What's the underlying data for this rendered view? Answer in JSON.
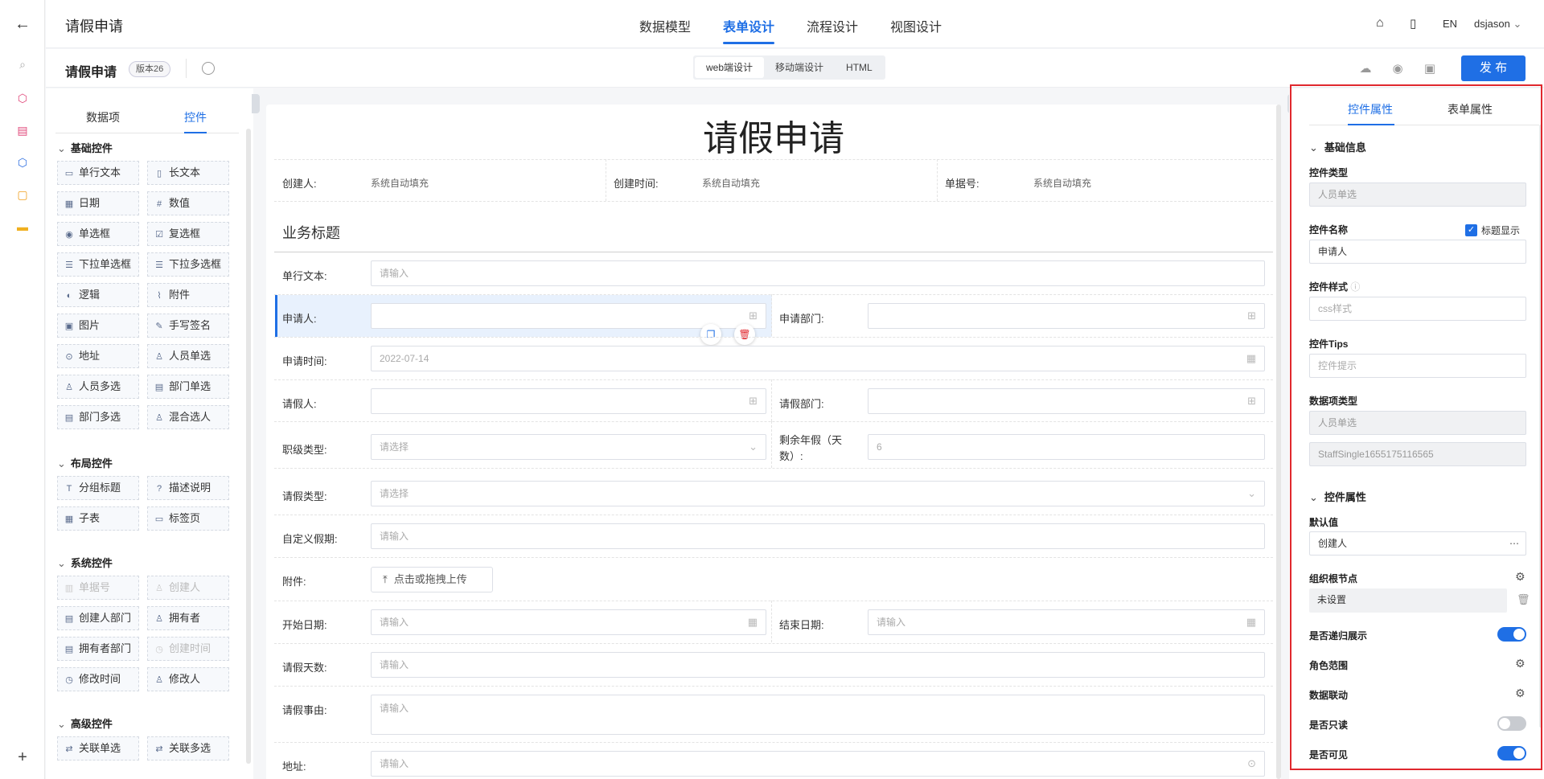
{
  "header": {
    "app_title": "请假申请",
    "nav_tabs": [
      "数据模型",
      "表单设计",
      "流程设计",
      "视图设计"
    ],
    "active_tab": "表单设计",
    "lang": "EN",
    "user": "dsjason"
  },
  "subheader": {
    "form_name": "请假申请",
    "version": "版本26",
    "modes": [
      "web端设计",
      "移动端设计",
      "HTML"
    ],
    "active_mode": "web端设计",
    "publish_label": "发 布"
  },
  "left_panel": {
    "tabs": [
      "数据项",
      "控件"
    ],
    "active_tab": "控件",
    "groups": [
      {
        "title": "基础控件",
        "items": [
          {
            "label": "单行文本",
            "icon": "input-icon"
          },
          {
            "label": "长文本",
            "icon": "textarea-icon"
          },
          {
            "label": "日期",
            "icon": "calendar-icon"
          },
          {
            "label": "数值",
            "icon": "number-icon"
          },
          {
            "label": "单选框",
            "icon": "radio-icon"
          },
          {
            "label": "复选框",
            "icon": "checkbox-icon"
          },
          {
            "label": "下拉单选框",
            "icon": "dropdown-icon"
          },
          {
            "label": "下拉多选框",
            "icon": "dropdown-multi-icon"
          },
          {
            "label": "逻辑",
            "icon": "toggle-icon"
          },
          {
            "label": "附件",
            "icon": "paperclip-icon"
          },
          {
            "label": "图片",
            "icon": "image-icon"
          },
          {
            "label": "手写签名",
            "icon": "pen-icon"
          },
          {
            "label": "地址",
            "icon": "location-icon"
          },
          {
            "label": "人员单选",
            "icon": "user-icon"
          },
          {
            "label": "人员多选",
            "icon": "users-icon"
          },
          {
            "label": "部门单选",
            "icon": "dept-icon"
          },
          {
            "label": "部门多选",
            "icon": "dept-multi-icon"
          },
          {
            "label": "混合选人",
            "icon": "user-mix-icon"
          }
        ]
      },
      {
        "title": "布局控件",
        "items": [
          {
            "label": "分组标题",
            "icon": "text-icon"
          },
          {
            "label": "描述说明",
            "icon": "help-icon"
          },
          {
            "label": "子表",
            "icon": "table-icon"
          },
          {
            "label": "标签页",
            "icon": "tabs-icon"
          }
        ]
      },
      {
        "title": "系统控件",
        "items": [
          {
            "label": "单据号",
            "icon": "barcode-icon",
            "disabled": true
          },
          {
            "label": "创建人",
            "icon": "user-icon",
            "disabled": true
          },
          {
            "label": "创建人部门",
            "icon": "dept-icon"
          },
          {
            "label": "拥有者",
            "icon": "user-icon"
          },
          {
            "label": "拥有者部门",
            "icon": "dept-icon"
          },
          {
            "label": "创建时间",
            "icon": "clock-icon",
            "disabled": true
          },
          {
            "label": "修改时间",
            "icon": "clock-icon"
          },
          {
            "label": "修改人",
            "icon": "user-icon"
          }
        ]
      },
      {
        "title": "高级控件",
        "items": [
          {
            "label": "关联单选",
            "icon": "link-icon"
          },
          {
            "label": "关联多选",
            "icon": "link-multi-icon"
          }
        ]
      }
    ]
  },
  "canvas": {
    "title": "请假申请",
    "meta": [
      {
        "label": "创建人:",
        "value": "系统自动填充"
      },
      {
        "label": "创建时间:",
        "value": "系统自动填充"
      },
      {
        "label": "单据号:",
        "value": "系统自动填充"
      }
    ],
    "section_title": "业务标题",
    "fields": {
      "single_text": {
        "label": "单行文本:",
        "placeholder": "请输入"
      },
      "applicant": {
        "label": "申请人:"
      },
      "apply_dept": {
        "label": "申请部门:"
      },
      "apply_time": {
        "label": "申请时间:",
        "value": "2022-07-14"
      },
      "leave_person": {
        "label": "请假人:"
      },
      "leave_dept": {
        "label": "请假部门:"
      },
      "rank_type": {
        "label": "职级类型:",
        "placeholder": "请选择"
      },
      "remaining": {
        "label": "剩余年假（天数）:",
        "value": "6"
      },
      "leave_type": {
        "label": "请假类型:",
        "placeholder": "请选择"
      },
      "custom_leave": {
        "label": "自定义假期:",
        "placeholder": "请输入"
      },
      "attachment": {
        "label": "附件:",
        "button": "点击或拖拽上传"
      },
      "start_date": {
        "label": "开始日期:",
        "placeholder": "请输入"
      },
      "end_date": {
        "label": "结束日期:",
        "placeholder": "请输入"
      },
      "days": {
        "label": "请假天数:",
        "placeholder": "请输入"
      },
      "reason": {
        "label": "请假事由:",
        "placeholder": "请输入"
      },
      "address": {
        "label": "地址:",
        "placeholder": "请输入"
      }
    }
  },
  "right_panel": {
    "tabs": [
      "控件属性",
      "表单属性"
    ],
    "active_tab": "控件属性",
    "basic_section": "基础信息",
    "control_type": {
      "label": "控件类型",
      "value": "人员单选"
    },
    "control_name": {
      "label": "控件名称",
      "value": "申请人",
      "show_title_label": "标题显示",
      "show_title": true
    },
    "control_style": {
      "label": "控件样式",
      "placeholder": "css样式"
    },
    "control_tips": {
      "label": "控件Tips",
      "placeholder": "控件提示"
    },
    "data_type": {
      "label": "数据项类型",
      "value": "人员单选",
      "code": "StaffSingle1655175116565"
    },
    "prop_section": "控件属性",
    "default_value": {
      "label": "默认值",
      "value": "创建人"
    },
    "org_root": {
      "label": "组织根节点",
      "value": "未设置"
    },
    "recursive": {
      "label": "是否递归展示",
      "on": true
    },
    "role_scope": {
      "label": "角色范围"
    },
    "data_link": {
      "label": "数据联动"
    },
    "readonly": {
      "label": "是否只读",
      "on": false
    },
    "visible": {
      "label": "是否可见",
      "on": true
    }
  },
  "colors": {
    "accent": "#1f6fe5",
    "highlight_border": "#e0282e"
  }
}
